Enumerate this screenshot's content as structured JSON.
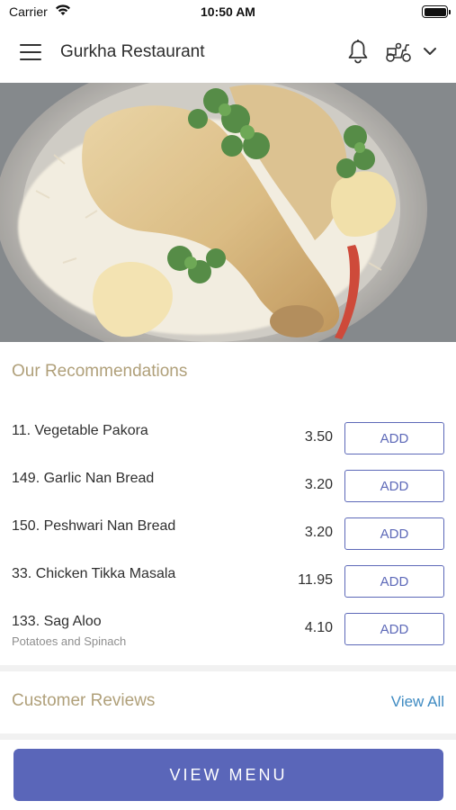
{
  "status_bar": {
    "carrier": "Carrier",
    "time": "10:50 AM"
  },
  "header": {
    "title": "Gurkha Restaurant"
  },
  "recommendations": {
    "title": "Our Recommendations",
    "items": [
      {
        "name": "11. Vegetable Pakora",
        "price": "3.50",
        "button": "ADD"
      },
      {
        "name": "149. Garlic Nan Bread",
        "price": "3.20",
        "button": "ADD"
      },
      {
        "name": "150. Peshwari Nan Bread",
        "price": "3.20",
        "button": "ADD"
      },
      {
        "name": "33. Chicken Tikka Masala",
        "price": "11.95",
        "button": "ADD"
      },
      {
        "name": "133. Sag Aloo",
        "subtitle": "Potatoes and Spinach",
        "price": "4.10",
        "button": "ADD"
      }
    ]
  },
  "reviews": {
    "title": "Customer Reviews",
    "view_all": "View All"
  },
  "footer": {
    "menu_button": "VIEW MENU"
  },
  "icons": [
    "wifi-icon",
    "battery-icon",
    "hamburger-menu-icon",
    "bell-icon",
    "delivery-scooter-icon",
    "chevron-down-icon"
  ],
  "colors": {
    "accent": "#5a66b9",
    "section_title": "#b0a07a",
    "link": "#3f8bc2"
  }
}
